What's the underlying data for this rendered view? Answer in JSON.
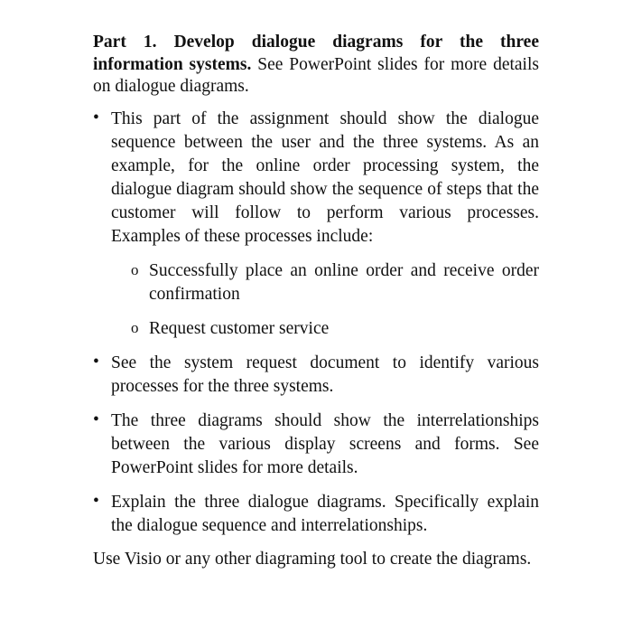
{
  "intro": {
    "heading_bold": "Part 1. Develop dialogue diagrams for the three information systems.",
    "heading_rest": " See PowerPoint slides for more details on dialogue diagrams."
  },
  "bullets": [
    {
      "marker": "•",
      "text": "This part of the assignment should show the dialogue sequence between the user and the three systems. As an example, for the online order processing system, the dialogue diagram should show the sequence of steps that the customer will follow to perform various processes. Examples of these processes include:"
    },
    {
      "marker": "•",
      "text": "See the system request document to identify various processes for the three systems."
    },
    {
      "marker": "•",
      "text": "The three diagrams should show the interrelationships between the various display screens and forms. See PowerPoint slides for more details."
    },
    {
      "marker": "•",
      "text": "Explain the three dialogue diagrams. Specifically explain the dialogue sequence and interrelationships."
    }
  ],
  "sub_bullets": [
    {
      "marker": "o",
      "text": "Successfully place an online order and receive order confirmation"
    },
    {
      "marker": "o",
      "text": "Request customer service"
    }
  ],
  "closing": "Use Visio or any other diagraming tool to create the diagrams."
}
